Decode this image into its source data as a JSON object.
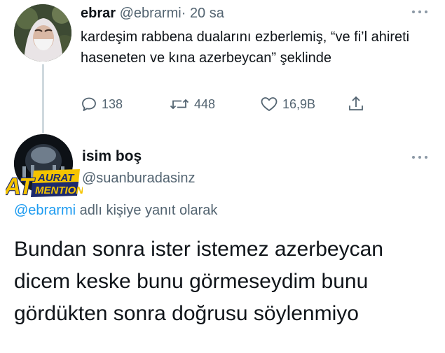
{
  "tweet1": {
    "display_name": "ebrar",
    "handle": "@ebrarmi",
    "separator": "·",
    "time": "20 sa",
    "text": "kardeşim rabbena dualarını ezberlemiş, “ve fi’l ahireti haseneten ve kına azerbeycan” şeklinde",
    "replies": "138",
    "retweets": "448",
    "likes": "16,9B"
  },
  "tweet2": {
    "display_name": "isim boş",
    "handle": "@suanburadasinz",
    "reply_mention": "@ebrarmi",
    "reply_suffix": "adlı kişiye yanıt olarak",
    "text": "Bundan sonra ister istemez azerbeycan dicem keske bunu görmeseydim bunu gördükten sonra doğrusu söylenmiyo"
  },
  "watermark": {
    "line1": "AURAT",
    "line2": "MENTION",
    "monogram": "AT"
  },
  "icons": {
    "reply": "reply-icon",
    "retweet": "retweet-icon",
    "like": "heart-icon",
    "share": "share-icon",
    "more": "more-dots-icon"
  },
  "colors": {
    "text": "#0f1419",
    "secondary": "#536471",
    "link": "#1d9bf0",
    "watermark_yellow": "#f5c400",
    "watermark_navy": "#1c2a6e"
  }
}
